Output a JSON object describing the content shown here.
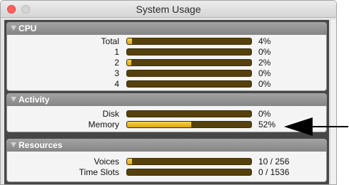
{
  "window": {
    "title": "System Usage"
  },
  "sections": [
    {
      "title": "CPU",
      "rows": [
        {
          "label": "Total",
          "value": "4%",
          "level": 0.04
        },
        {
          "label": "1",
          "value": "0%",
          "level": 0
        },
        {
          "label": "2",
          "value": "2%",
          "level": 0.02
        },
        {
          "label": "3",
          "value": "0%",
          "level": 0
        },
        {
          "label": "4",
          "value": "0%",
          "level": 0
        }
      ]
    },
    {
      "title": "Activity",
      "rows": [
        {
          "label": "Disk",
          "value": "0%",
          "level": 0
        },
        {
          "label": "Memory",
          "value": "52%",
          "level": 0.52
        }
      ]
    },
    {
      "title": "Resources",
      "rows": [
        {
          "label": "Voices",
          "value": "10 / 256",
          "level": 0.039
        },
        {
          "label": "Time Slots",
          "value": "0 / 1536",
          "level": 0
        }
      ]
    }
  ],
  "colors": {
    "bar_track": "#56410d",
    "bar_fill": "#e8b824",
    "section_header": "#959595",
    "background": "#474747",
    "arrow": "#000000"
  },
  "icons": {
    "close": "close-button-icon",
    "minimize": "minimize-button-icon",
    "disclosure": "disclosure-triangle-icon",
    "annotation": "arrow-left-icon"
  }
}
